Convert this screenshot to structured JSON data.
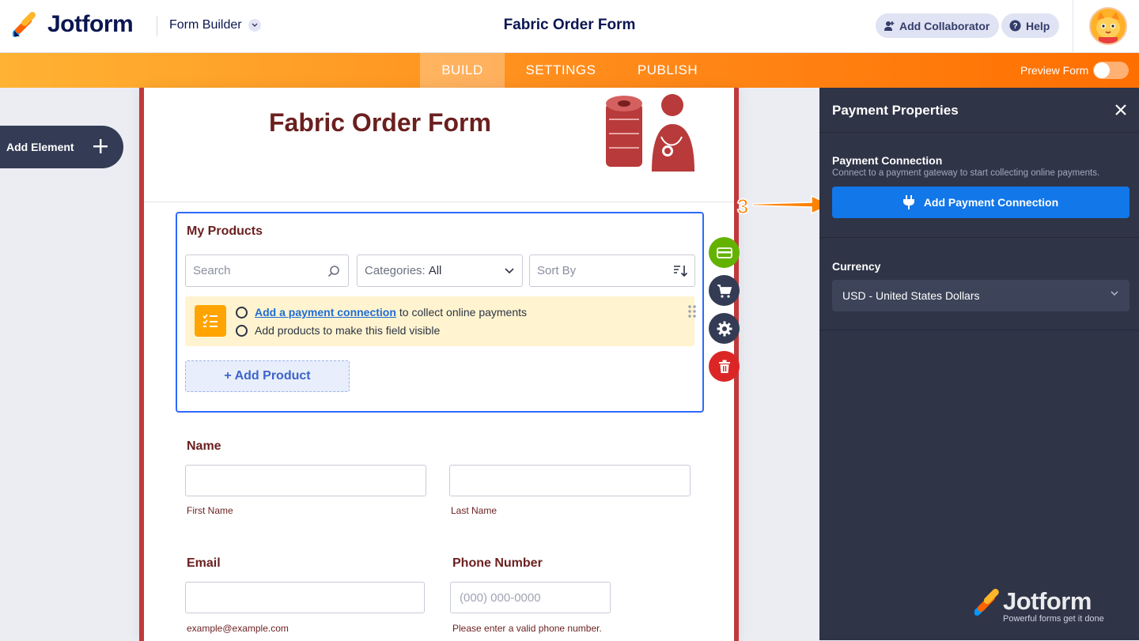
{
  "app": {
    "brand": "Jotform",
    "builder_menu": "Form Builder",
    "form_title": "Fabric Order Form",
    "add_collaborator": "Add Collaborator",
    "help": "Help"
  },
  "nav": {
    "tabs": [
      {
        "label": "BUILD",
        "active": true
      },
      {
        "label": "SETTINGS",
        "active": false
      },
      {
        "label": "PUBLISH",
        "active": false
      }
    ],
    "preview_label": "Preview Form",
    "preview_on": false
  },
  "left": {
    "add_element": "Add Element"
  },
  "form": {
    "title": "Fabric Order Form",
    "products": {
      "label": "My Products",
      "search_placeholder": "Search",
      "categories_label": "Categories:",
      "categories_value": "All",
      "sort_label": "Sort By",
      "notice_link": "Add a payment connection",
      "notice_rest": "to collect online payments",
      "notice_line2": "Add products to make this field visible",
      "add_product": "+ Add Product"
    },
    "name": {
      "label": "Name",
      "first": "First Name",
      "last": "Last Name"
    },
    "email": {
      "label": "Email",
      "hint": "example@example.com"
    },
    "phone": {
      "label": "Phone Number",
      "placeholder": "(000) 000-0000",
      "hint": "Please enter a valid phone number."
    }
  },
  "panel": {
    "title": "Payment Properties",
    "connection_title": "Payment Connection",
    "connection_sub": "Connect to a payment gateway to start collecting online payments.",
    "connection_button": "Add Payment Connection",
    "currency_label": "Currency",
    "currency_value": "USD - United States Dollars",
    "watermark_brand": "Jotform",
    "watermark_tag": "Powerful forms get it done"
  },
  "annotation": {
    "step": "3"
  },
  "colors": {
    "brand_navy": "#0a1551",
    "nav_orange": "#ff8a1a",
    "form_border": "#c0393b",
    "form_text": "#6b1f1f",
    "panel_bg": "#2f3447",
    "primary_blue": "#1277e8",
    "tool_green": "#64b200",
    "tool_dark": "#343c55",
    "tool_red": "#dc2626"
  }
}
